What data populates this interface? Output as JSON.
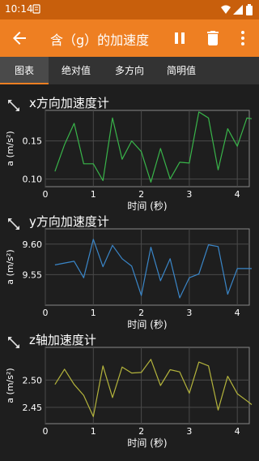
{
  "status": {
    "time": "10:14"
  },
  "appbar": {
    "title": "含（g）的加速度"
  },
  "tabs": [
    "图表",
    "绝对值",
    "多方向",
    "简明值"
  ],
  "panels": [
    {
      "title": "x方向加速度计",
      "ylabel": "a (m/s²)",
      "xlabel": "时间 (秒)"
    },
    {
      "title": "y方向加速度计",
      "ylabel": "a (m/s²)",
      "xlabel": "时间 (秒)"
    },
    {
      "title": "z轴加速度计",
      "ylabel": "a (m/s²)",
      "xlabel": "时间 (秒)"
    }
  ],
  "colors": {
    "accent": "#ee7f22",
    "x": "#39b54a",
    "y": "#3a86c8",
    "z": "#b4b43c"
  },
  "chart_data": [
    {
      "type": "line",
      "title": "x方向加速度计",
      "xlabel": "时间 (秒)",
      "ylabel": "a (m/s²)",
      "xlim": [
        0,
        4.25
      ],
      "ylim": [
        0.09,
        0.19
      ],
      "xticks": [
        0,
        1,
        2,
        3,
        4
      ],
      "yticks": [
        0.1,
        0.15
      ],
      "ytick_labels": [
        "0.10",
        "0.15"
      ],
      "color": "#39b54a",
      "x": [
        0.2,
        0.4,
        0.6,
        0.8,
        1.0,
        1.2,
        1.4,
        1.6,
        1.8,
        2.0,
        2.2,
        2.4,
        2.6,
        2.8,
        3.0,
        3.2,
        3.4,
        3.6,
        3.8,
        4.0,
        4.2,
        4.3
      ],
      "y": [
        0.11,
        0.145,
        0.173,
        0.12,
        0.12,
        0.098,
        0.18,
        0.126,
        0.15,
        0.136,
        0.096,
        0.14,
        0.1,
        0.122,
        0.121,
        0.188,
        0.18,
        0.112,
        0.166,
        0.143,
        0.18,
        0.179
      ]
    },
    {
      "type": "line",
      "title": "y方向加速度计",
      "xlabel": "时间 (秒)",
      "ylabel": "a (m/s²)",
      "xlim": [
        0,
        4.25
      ],
      "ylim": [
        9.5,
        9.625
      ],
      "xticks": [
        0,
        1,
        2,
        3,
        4
      ],
      "yticks": [
        9.55,
        9.6
      ],
      "ytick_labels": [
        "9.55",
        "9.60"
      ],
      "color": "#3a86c8",
      "x": [
        0.2,
        0.4,
        0.6,
        0.8,
        1.0,
        1.2,
        1.4,
        1.6,
        1.8,
        2.0,
        2.2,
        2.4,
        2.6,
        2.8,
        3.0,
        3.2,
        3.4,
        3.6,
        3.8,
        4.0,
        4.2,
        4.3
      ],
      "y": [
        9.566,
        9.569,
        9.572,
        9.545,
        9.608,
        9.563,
        9.598,
        9.576,
        9.564,
        9.516,
        9.595,
        9.54,
        9.576,
        9.512,
        9.545,
        9.551,
        9.599,
        9.596,
        9.518,
        9.56,
        9.56,
        9.56
      ]
    },
    {
      "type": "line",
      "title": "z轴加速度计",
      "xlabel": "时间 (秒)",
      "ylabel": "a (m/s²)",
      "xlim": [
        0,
        4.25
      ],
      "ylim": [
        2.42,
        2.56
      ],
      "xticks": [
        0,
        1,
        2,
        3,
        4
      ],
      "yticks": [
        2.45,
        2.5
      ],
      "ytick_labels": [
        "2.45",
        "2.50"
      ],
      "color": "#b4b43c",
      "x": [
        0.2,
        0.4,
        0.6,
        0.8,
        1.0,
        1.2,
        1.4,
        1.6,
        1.8,
        2.0,
        2.2,
        2.4,
        2.6,
        2.8,
        3.0,
        3.2,
        3.4,
        3.6,
        3.8,
        4.0,
        4.2,
        4.3
      ],
      "y": [
        2.492,
        2.52,
        2.492,
        2.472,
        2.433,
        2.526,
        2.468,
        2.524,
        2.513,
        2.514,
        2.538,
        2.49,
        2.519,
        2.515,
        2.476,
        2.533,
        2.526,
        2.445,
        2.507,
        2.475,
        2.462,
        2.455
      ]
    }
  ]
}
